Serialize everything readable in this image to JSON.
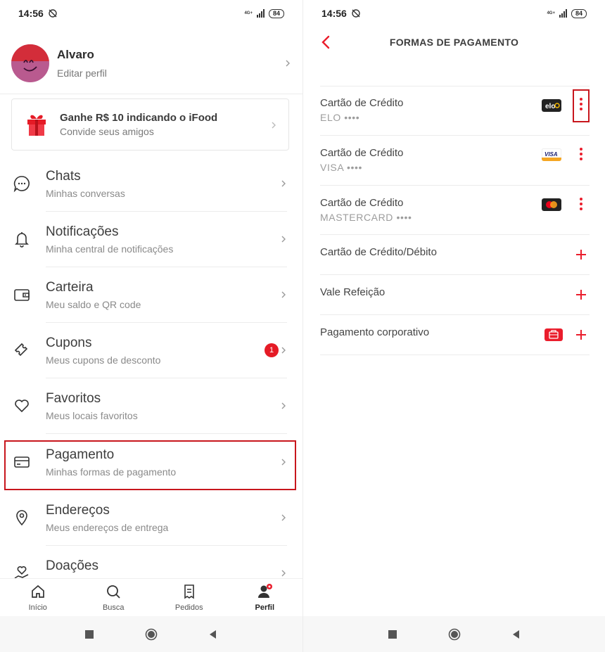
{
  "left": {
    "status": {
      "time": "14:56",
      "battery": "84",
      "network": "4G+"
    },
    "profile": {
      "name": "Alvaro",
      "subtitle": "Editar perfil"
    },
    "invite": {
      "title": "Ganhe R$ 10 indicando o iFood",
      "subtitle": "Convide seus amigos"
    },
    "menu": [
      {
        "label": "Chats",
        "desc": "Minhas conversas",
        "icon": "chat-icon"
      },
      {
        "label": "Notificações",
        "desc": "Minha central de notificações",
        "icon": "bell-icon"
      },
      {
        "label": "Carteira",
        "desc": "Meu saldo e QR code",
        "icon": "wallet-icon"
      },
      {
        "label": "Cupons",
        "desc": "Meus cupons de desconto",
        "icon": "ticket-icon",
        "badge": "1"
      },
      {
        "label": "Favoritos",
        "desc": "Meus locais favoritos",
        "icon": "heart-icon"
      },
      {
        "label": "Pagamento",
        "desc": "Minhas formas de pagamento",
        "icon": "card-icon"
      },
      {
        "label": "Endereços",
        "desc": "Meus endereços de entrega",
        "icon": "location-pin-icon"
      },
      {
        "label": "Doações",
        "desc": "",
        "icon": "donation-icon"
      }
    ],
    "bottom_nav": [
      {
        "label": "Início",
        "icon": "home-icon"
      },
      {
        "label": "Busca",
        "icon": "search-icon"
      },
      {
        "label": "Pedidos",
        "icon": "orders-icon"
      },
      {
        "label": "Perfil",
        "icon": "profile-icon",
        "active": true
      }
    ]
  },
  "right": {
    "status": {
      "time": "14:56",
      "battery": "84",
      "network": "4G+"
    },
    "title": "FORMAS DE PAGAMENTO",
    "cards": [
      {
        "name": "Cartão de Crédito",
        "number": "ELO ••••",
        "brand": "elo"
      },
      {
        "name": "Cartão de Crédito",
        "number": "VISA ••••",
        "brand": "visa"
      },
      {
        "name": "Cartão de Crédito",
        "number": "MASTERCARD ••••",
        "brand": "mastercard"
      }
    ],
    "add_options": [
      {
        "name": "Cartão de Crédito/Débito"
      },
      {
        "name": "Vale Refeição"
      },
      {
        "name": "Pagamento corporativo",
        "icon": "briefcase-icon"
      }
    ]
  },
  "colors": {
    "accent": "#ea1d2c",
    "highlight": "#c8161d",
    "text": "#3e3e3e",
    "muted": "#8a8a8a"
  }
}
